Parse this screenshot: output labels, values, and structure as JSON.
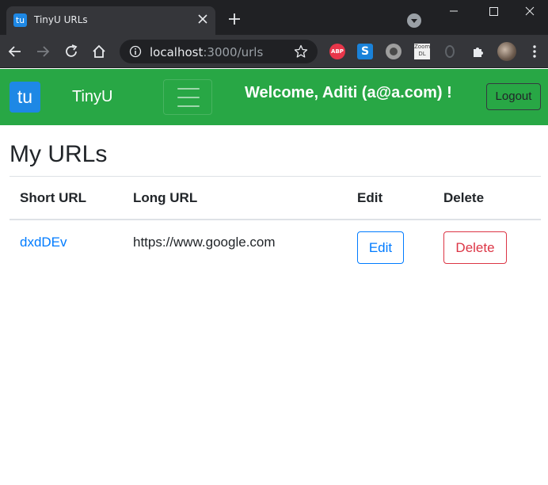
{
  "browser": {
    "tab": {
      "favicon_text": "tu",
      "title": "TinyU URLs",
      "favicon_color": "#1e88e5"
    },
    "omnibox": {
      "host": "localhost",
      "path": ":3000/urls"
    },
    "extensions": [
      {
        "icon": "adblock-plus-icon",
        "text": "ABP"
      },
      {
        "icon": "s-extension-icon",
        "text": "S"
      },
      {
        "icon": "circle-extension-icon"
      },
      {
        "icon": "zoom-dl-icon",
        "text": "Zoom DL"
      },
      {
        "icon": "ghost-extension-icon"
      },
      {
        "icon": "puzzle-extensions-icon"
      },
      {
        "icon": "profile-avatar-icon"
      },
      {
        "icon": "more-menu-icon"
      }
    ],
    "colors": {
      "tabbar_bg": "#202124",
      "toolbar_bg": "#35363a"
    }
  },
  "navbar": {
    "logo_text": "tu",
    "brand": "TinyU",
    "welcome": "Welcome, Aditi (a@a.com) !",
    "logout_label": "Logout",
    "colors": {
      "navbar_bg": "#28a745",
      "logo_bg": "#1e88e5"
    }
  },
  "main": {
    "title": "My URLs",
    "table": {
      "headers": [
        "Short URL",
        "Long URL",
        "Edit",
        "Delete"
      ],
      "rows": [
        {
          "short_url": "dxdDEv",
          "long_url": "https://www.google.com",
          "edit_label": "Edit",
          "delete_label": "Delete"
        }
      ]
    },
    "colors": {
      "link": "#007bff",
      "danger": "#dc3545"
    }
  }
}
